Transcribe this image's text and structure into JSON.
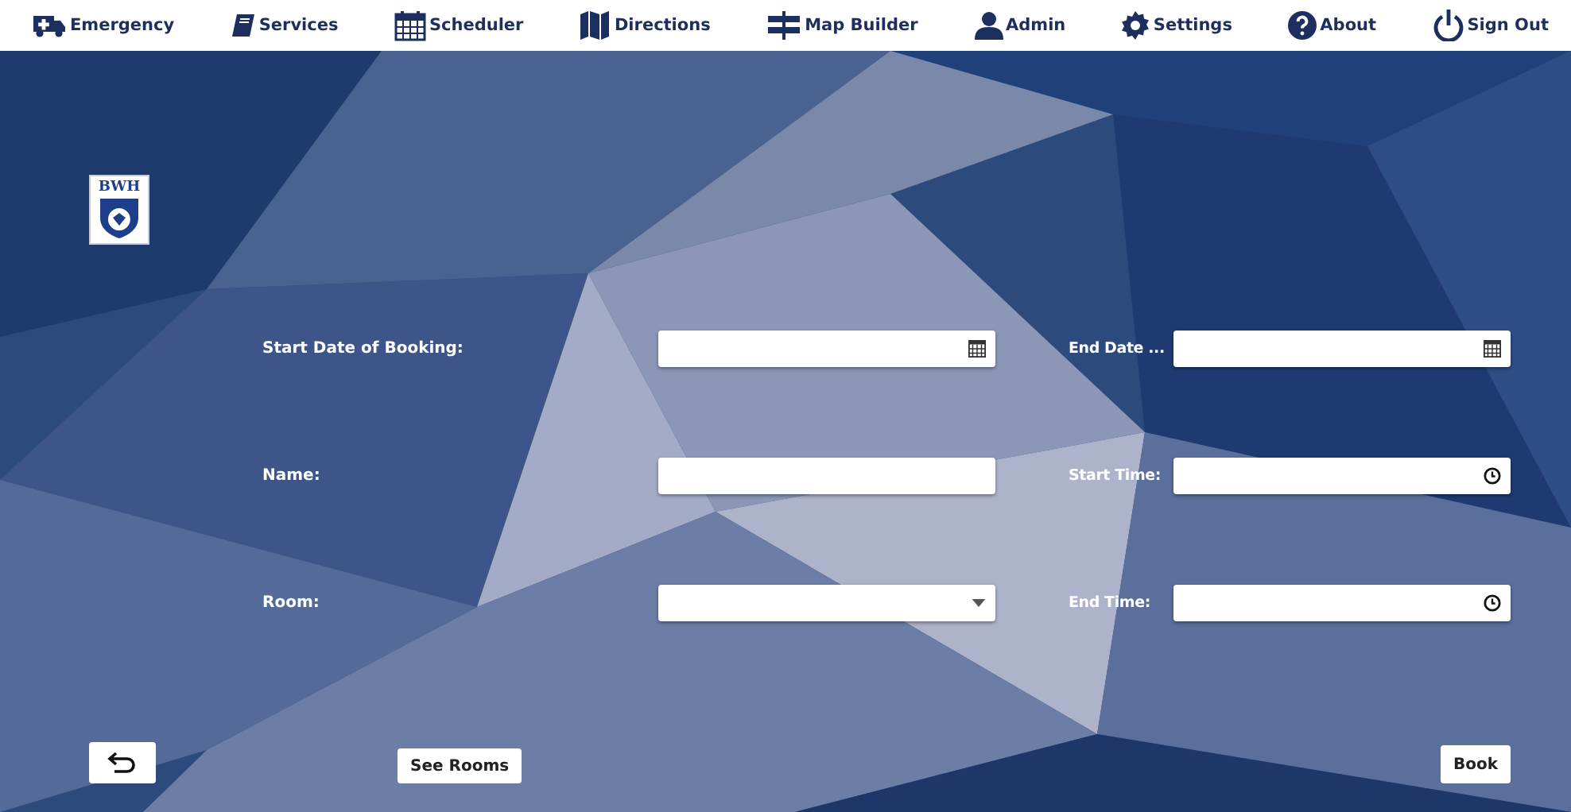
{
  "nav": [
    {
      "label": "Emergency"
    },
    {
      "label": "Services"
    },
    {
      "label": "Scheduler"
    },
    {
      "label": "Directions"
    },
    {
      "label": "Map Builder"
    },
    {
      "label": "Admin"
    },
    {
      "label": "Settings"
    },
    {
      "label": "About"
    },
    {
      "label": "Sign Out"
    }
  ],
  "logo": {
    "text": "BWH"
  },
  "fields": [
    {
      "label": "Start Date of Booking:",
      "kind": "date"
    },
    {
      "label": "End Date ...",
      "kind": "date"
    },
    {
      "label": "Name:",
      "kind": "text"
    },
    {
      "label": "Start Time:",
      "kind": "time"
    },
    {
      "label": "Room:",
      "kind": "dropdown"
    },
    {
      "label": "End Time:",
      "kind": "time"
    }
  ],
  "buttons": {
    "see_rooms": "See Rooms",
    "book": "Book"
  }
}
